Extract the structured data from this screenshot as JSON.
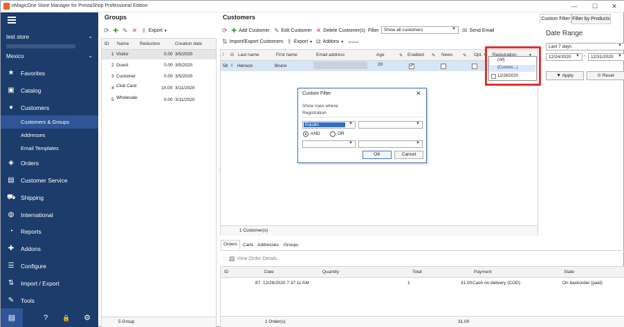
{
  "window": {
    "title": "eMagicOne Store Manager for PrestaShop Professional Edition",
    "controls": {
      "minimize": "—",
      "maximize": "☐",
      "close": "✕"
    }
  },
  "sidebar": {
    "store": "test store",
    "country": "Mexico",
    "nav": [
      {
        "label": "Favorites",
        "icon": "star-icon",
        "glyph": "★"
      },
      {
        "label": "Catalog",
        "icon": "catalog-icon",
        "glyph": "▣"
      },
      {
        "label": "Customers",
        "icon": "person-icon",
        "glyph": "●"
      },
      {
        "label": "Orders",
        "icon": "box-icon",
        "glyph": "◈"
      },
      {
        "label": "Customer Service",
        "icon": "chat-icon",
        "glyph": "▤"
      },
      {
        "label": "Shipping",
        "icon": "truck-icon",
        "glyph": "⛟"
      },
      {
        "label": "International",
        "icon": "globe-icon",
        "glyph": "◍"
      },
      {
        "label": "Reports",
        "icon": "pie-chart-icon",
        "glyph": "◔"
      },
      {
        "label": "Addons",
        "icon": "puzzle-icon",
        "glyph": "✚"
      },
      {
        "label": "Configure",
        "icon": "sliders-icon",
        "glyph": "☰"
      },
      {
        "label": "Import / Export",
        "icon": "import-export-icon",
        "glyph": "⇅"
      },
      {
        "label": "Tools",
        "icon": "wrench-icon",
        "glyph": "✎"
      }
    ],
    "sub": [
      "Customers & Groups",
      "Addresses",
      "Email Templates"
    ],
    "bottom": {
      "store": "▤",
      "help": "?",
      "lock": "🔒",
      "settings": "⚙"
    }
  },
  "groups": {
    "title": "Groups",
    "export": "Export",
    "columns": [
      "ID",
      "Name",
      "Reduction",
      "Creation date"
    ],
    "rows": [
      {
        "id": "1",
        "name": "Visitor",
        "reduction": "0.00",
        "date": "3/5/2020"
      },
      {
        "id": "2",
        "name": "Guest",
        "reduction": "0.00",
        "date": "3/5/2020"
      },
      {
        "id": "3",
        "name": "Customer",
        "reduction": "0.00",
        "date": "3/5/2020"
      },
      {
        "id": "4",
        "name": "Club Card",
        "reduction": "10.00",
        "date": "3/11/2020"
      },
      {
        "id": "5",
        "name": "Wholesale",
        "reduction": "0.00",
        "date": "3/11/2020"
      }
    ],
    "footer": "5 Group"
  },
  "customers": {
    "title": "Customers",
    "toolbar": {
      "add": "Add Customer",
      "edit": "Edit Customer",
      "delete": "Delete Customer(s)",
      "filter_label": "Filter",
      "filter_value": "Show all customers",
      "send_email": "Send Email",
      "import_export": "Import/Export Customers",
      "export": "Export",
      "addons": "Addons"
    },
    "columns": [
      "G",
      "Last name",
      "First name",
      "Email address",
      "Age",
      "Enabled",
      "News",
      "Opt.",
      "Registration"
    ],
    "row": {
      "id": "58",
      "last": "Henson",
      "first": "Bruno",
      "age": "20",
      "enabled": true,
      "news": false,
      "opt": false
    },
    "footer": "1 Customer(s)",
    "registration_dropdown": [
      "(All)",
      "(Custom...)",
      "12/28/2020"
    ]
  },
  "dialog": {
    "title": "Custom Filter",
    "show_rows": "Show rows where:",
    "field": "Registration",
    "operator": "Equals",
    "and_label": "AND",
    "or_label": "OR",
    "ok": "OK",
    "cancel": "Cancel"
  },
  "right": {
    "tabs": [
      "Custom Filter",
      "Filter by Products"
    ],
    "date_range_title": "Date Range",
    "range": "Last 7 days",
    "from": "12/24/2020",
    "to": "12/31/2020",
    "apply": "Apply",
    "reset": "Reset"
  },
  "orders": {
    "tabs": [
      "Orders",
      "Carts",
      "Addresses",
      "Groups"
    ],
    "view_details": "View Order Details",
    "columns": [
      "ID",
      "Date",
      "Quantity",
      "Total",
      "Payment",
      "State"
    ],
    "row": {
      "id": "87",
      "date": "12/28/2020 7:37:11 AM",
      "quantity": "1",
      "total": "31.00",
      "payment": "Cash on delivery (COD)",
      "state": "On backorder (paid)"
    },
    "footer_count": "1 Order(s)",
    "footer_total": "31.00"
  }
}
